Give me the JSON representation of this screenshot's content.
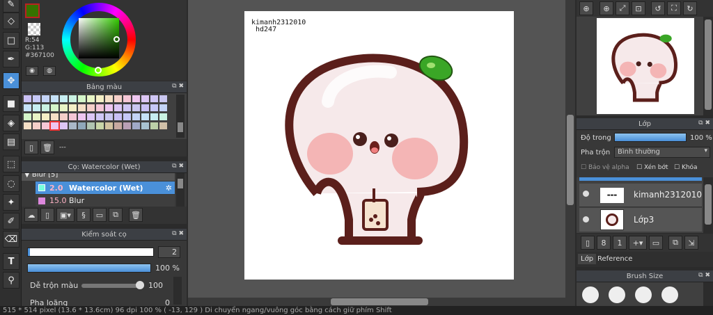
{
  "color": {
    "r_label": "R:54",
    "g_label": "G:113",
    "hex_label": "#367100"
  },
  "palette_panel": {
    "title": "Bảng màu",
    "footer_text": "---"
  },
  "brush_panel": {
    "title": "Cọ: Watercolor (Wet)",
    "items": [
      {
        "label": "Blur [5]",
        "size": ""
      },
      {
        "label": "Watercolor (Wet)",
        "size": "2.0"
      },
      {
        "label": "Blur",
        "size": "15.0"
      }
    ]
  },
  "brush_control": {
    "title": "Kiểm soát cọ",
    "size_value": "2",
    "opacity_value": "100 %",
    "blend_label": "Dễ trộn màu",
    "blend_value": "100",
    "next_label": "Pha loãng",
    "next_value": "0"
  },
  "canvas": {
    "watermark_line1": "kimanh2312010",
    "watermark_line2": "hd247"
  },
  "layer_panel": {
    "title": "Lớp",
    "opacity_label": "Độ trong",
    "opacity_value": "100 %",
    "blend_label": "Pha trộn",
    "blend_value": "Bình thường",
    "protect_alpha": "Bảo vệ alpha",
    "clip": "Xén bớt",
    "lock": "Khóa",
    "layers": [
      {
        "name": "kimanh2312010"
      },
      {
        "name": "Lớp3"
      }
    ],
    "tabs": [
      "Lớp",
      "Reference"
    ]
  },
  "brush_size_panel": {
    "title": "Brush Size"
  },
  "status": {
    "text": "515 * 514 pixel   (13.6 * 13.6cm)   96 dpi   100 %   ( -13, 129 )   Di chuyển ngang/vuông góc bằng cách giữ phím Shift"
  },
  "colors": {
    "current": "#367100",
    "accent": "#4a90d9",
    "panel": "#383838"
  }
}
